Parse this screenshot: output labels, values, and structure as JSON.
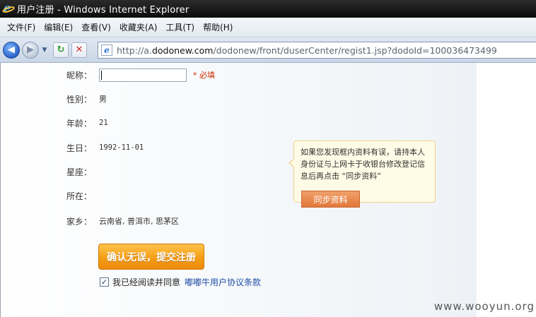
{
  "window": {
    "title": "用户注册 - Windows Internet Explorer"
  },
  "menubar": {
    "items": [
      "文件(F)",
      "编辑(E)",
      "查看(V)",
      "收藏夹(A)",
      "工具(T)",
      "帮助(H)"
    ]
  },
  "navbar": {
    "url_prefix": "http://a.",
    "url_host": "dodonew.com",
    "url_path": "/dodonew/front/duserCenter/regist1.jsp?dodoId=100036473499"
  },
  "form": {
    "nickname": {
      "label": "昵称：",
      "value": "",
      "required": "* 必填"
    },
    "gender": {
      "label": "性别：",
      "value": "男"
    },
    "age": {
      "label": "年龄：",
      "value": "21"
    },
    "birthday": {
      "label": "生日：",
      "value": "1992-11-01"
    },
    "constellation": {
      "label": "星座：",
      "value": ""
    },
    "location": {
      "label": "所在：",
      "value": ""
    },
    "hometown": {
      "label": "家乡：",
      "value": "云南省, 普洱市, 思茅区"
    }
  },
  "tip": {
    "text": "如果您发现框内资料有误，请持本人身份证与上网卡于收银台修改登记信息后再点击 “同步资料”",
    "button": "同步资料"
  },
  "submit": {
    "label": "确认无误，提交注册"
  },
  "agreement": {
    "checked": true,
    "check_mark": "✓",
    "text": "我已经阅读并同意",
    "link": "嘟嘟牛用户协议条款"
  },
  "watermark": "www.wooyun.org"
}
